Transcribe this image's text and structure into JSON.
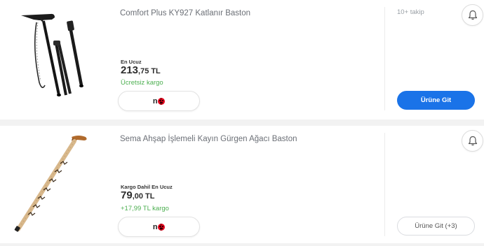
{
  "products": [
    {
      "title": "Comfort Plus KY927 Katlanır Baston",
      "price_label": "En Ucuz",
      "price_int": "213",
      "price_dec": ",75",
      "currency": "TL",
      "shipping": "Ücretsiz kargo",
      "seller_logo_text": "n",
      "follow_count": "10+ takip",
      "button_label": "Ürüne Git",
      "image_icon": "folding-cane",
      "bell_icon": "bell-icon"
    },
    {
      "title": "Sema Ahşap İşlemeli Kayın Gürgen Ağacı Baston",
      "price_label": "Kargo Dahil En Ucuz",
      "price_int": "79",
      "price_dec": ",00",
      "currency": "TL",
      "shipping": "+17,99 TL kargo",
      "seller_logo_text": "n",
      "button_label": "Ürüne Git (+3)",
      "image_icon": "wooden-cane",
      "bell_icon": "bell-icon"
    }
  ],
  "colors": {
    "primary_button": "#1a73e8",
    "shipping_text": "#4caf50",
    "background": "#f2f2f2"
  }
}
